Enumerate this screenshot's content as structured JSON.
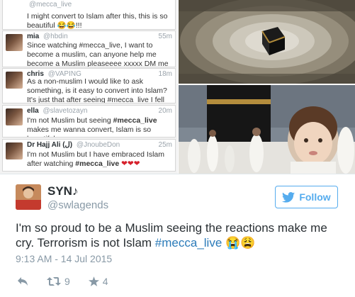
{
  "collage": {
    "tweets": [
      {
        "handle": "@mecca_live",
        "text": "I might convert to Islam after this, this is so beautiful 😂😂!!!"
      },
      {
        "name": "mia",
        "handle": "@hbdin",
        "time": "55m",
        "text_1": "Since watching #mecca_live, I want to become a muslim, can anyone help me become a Muslim pleaseeee xxxxx DM me",
        "emoji": "💙"
      },
      {
        "name": "chris",
        "handle": "@VAPING",
        "time": "18m",
        "text": "As a non-muslim I would like to ask something, is it easy to convert into Islam? It's just that after seeing #mecca_live I fell like in love"
      },
      {
        "name": "ella",
        "handle": "@slavetozayn",
        "time": "20m",
        "text_1": "I'm not Muslim but seeing ",
        "hashtag": "#mecca_live",
        "text_2": " makes me wanna convert, Islam is so beautiful"
      },
      {
        "name": "Dr Hajj Ali (ﻝ)",
        "handle": "@JnoubeDon",
        "time": "25m",
        "text_1": "I'm not Muslim but I have embraced Islam after watching ",
        "hashtag": "#mecca_live",
        "hearts": "❤❤❤"
      }
    ]
  },
  "tweet": {
    "author": {
      "name": "SYN♪",
      "handle": "@swlagends"
    },
    "follow_label": "Follow",
    "text_1": "I'm so proud to be a Muslim seeing the reactions make me cry. Terrorism is not Islam ",
    "hashtag": "#mecca_live",
    "emoji": " 😭😩",
    "date": "9:13 AM - 14 Jul 2015",
    "retweets": "9",
    "favorites": "4"
  },
  "colors": {
    "accent": "#55acee",
    "link": "#2b7bb9",
    "muted": "#8899a6",
    "text": "#292f33"
  },
  "icons": [
    "reply-icon",
    "retweet-icon",
    "favorite-star-icon",
    "twitter-bird-icon"
  ]
}
